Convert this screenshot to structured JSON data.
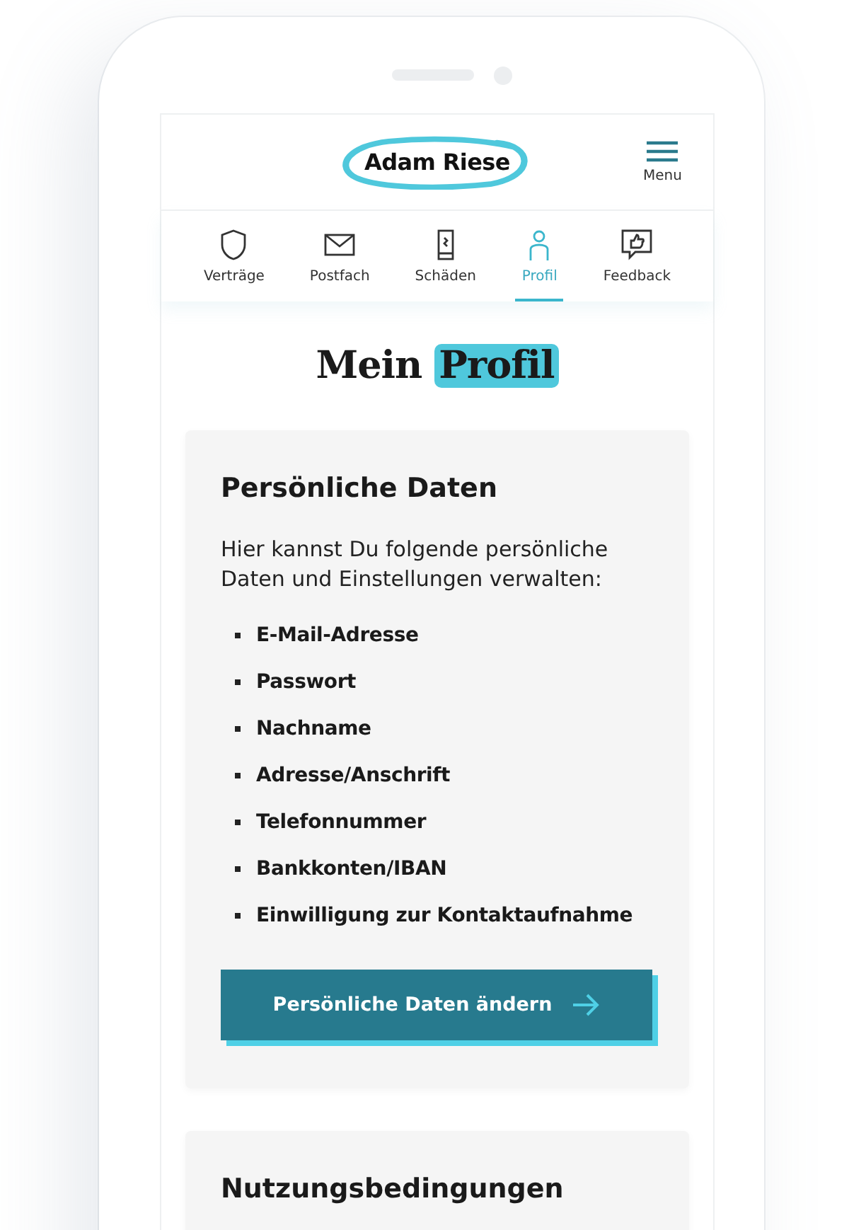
{
  "header": {
    "logo": "Adam Riese",
    "menu_label": "Menu"
  },
  "nav": [
    {
      "label": "Verträge",
      "selected": false
    },
    {
      "label": "Postfach",
      "selected": false
    },
    {
      "label": "Schäden",
      "selected": false
    },
    {
      "label": "Profil",
      "selected": true
    },
    {
      "label": "Feedback",
      "selected": false
    }
  ],
  "title": {
    "text": "Mein",
    "highlight": "Profil"
  },
  "cards": [
    {
      "heading": "Persönliche Daten",
      "intro": "Hier kannst Du folgende persönliche Daten und Einstellungen verwalten:",
      "items": [
        "E-Mail-Adresse",
        "Passwort",
        "Nachname",
        "Adresse/Anschrift",
        "Telefonnummer",
        "Bankkonten/IBAN",
        "Einwilligung zur Kontaktaufnahme"
      ],
      "button": "Persönliche Daten ändern"
    },
    {
      "heading": "Nutzungsbedingungen"
    }
  ]
}
